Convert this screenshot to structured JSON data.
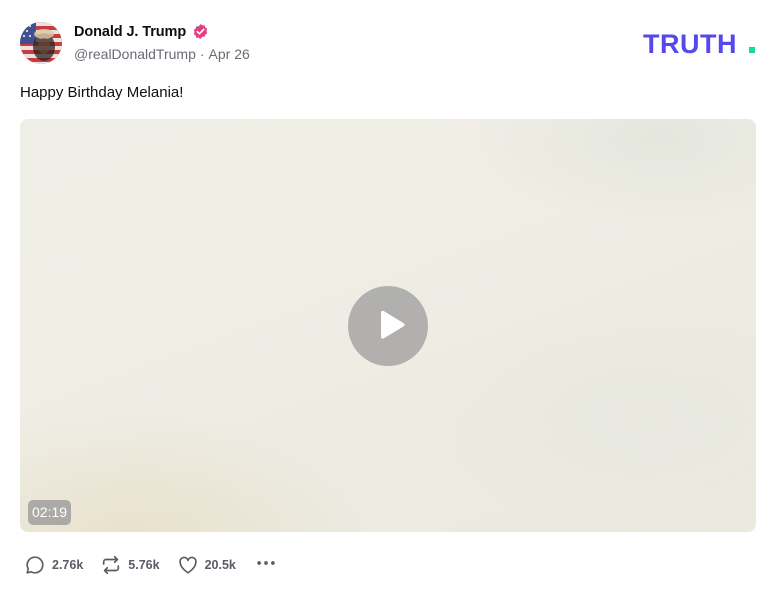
{
  "post": {
    "author": {
      "display_name": "Donald J. Trump",
      "verified_icon": "verified-badge-icon",
      "handle": "@realDonaldTrump",
      "separator": "·",
      "date": "Apr 26"
    },
    "text": "Happy Birthday Melania!",
    "media": {
      "type": "video",
      "duration": "02:19",
      "play_icon": "play-icon"
    },
    "stats": {
      "replies": "2.76k",
      "retruths": "5.76k",
      "likes": "20.5k"
    }
  },
  "brand": {
    "logo_text": "TRUTH",
    "logo_color": "#5448ee",
    "logo_dot_color": "#17d9a4"
  },
  "colors": {
    "verified": "#e0407e",
    "muted_text": "#6b6b76",
    "icon": "#5b5b66"
  }
}
